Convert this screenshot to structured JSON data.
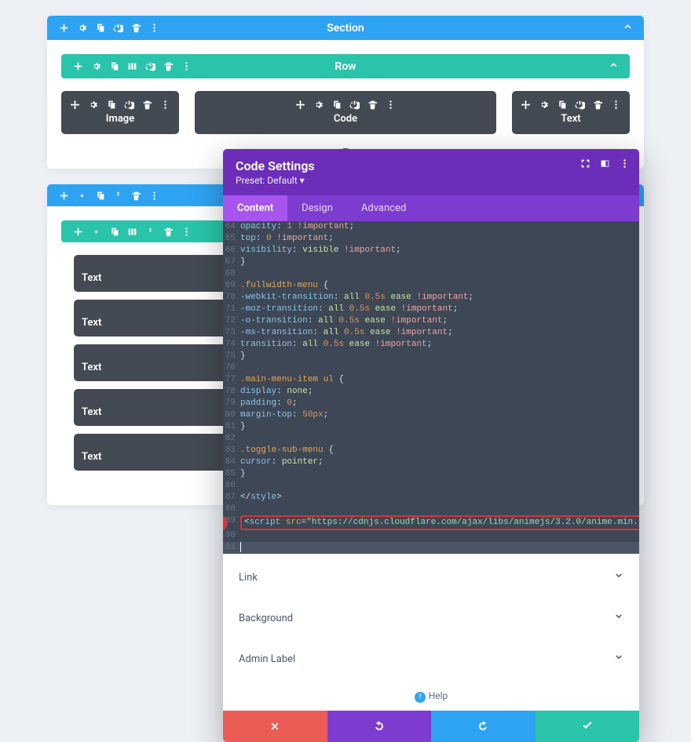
{
  "section1": {
    "title": "Section",
    "row": {
      "title": "Row",
      "mods": [
        "Image",
        "Code",
        "Text"
      ]
    }
  },
  "modal": {
    "title": "Code Settings",
    "preset": "Preset: Default",
    "tabs": [
      "Content",
      "Design",
      "Advanced"
    ],
    "code": {
      "start": 64,
      "lines": [
        {
          "t": "prop-imp",
          "prop": "opacity",
          "val": "1"
        },
        {
          "t": "prop-imp",
          "prop": "top",
          "val": "0"
        },
        {
          "t": "prop-kw-imp",
          "prop": "visibility",
          "kw": "visible"
        },
        {
          "t": "brace-close"
        },
        {
          "t": "blank"
        },
        {
          "t": "sel",
          "text": ".fullwidth-menu {"
        },
        {
          "t": "trans",
          "prop": "-webkit-transition"
        },
        {
          "t": "trans",
          "prop": "-moz-transition"
        },
        {
          "t": "trans",
          "prop": "-o-transition"
        },
        {
          "t": "trans",
          "prop": "-ms-transition"
        },
        {
          "t": "trans",
          "prop": "transition"
        },
        {
          "t": "brace-close"
        },
        {
          "t": "blank"
        },
        {
          "t": "sel",
          "text": ".main-menu-item ul {"
        },
        {
          "t": "prop-kw",
          "prop": "display",
          "kw": "none"
        },
        {
          "t": "prop-num",
          "prop": "padding",
          "num": "0"
        },
        {
          "t": "prop-num",
          "prop": "margin-top",
          "num": "50px"
        },
        {
          "t": "brace-close"
        },
        {
          "t": "blank"
        },
        {
          "t": "sel",
          "text": ".toggle-sub-menu {"
        },
        {
          "t": "prop-kw",
          "prop": "cursor",
          "kw": "pointer"
        },
        {
          "t": "brace-close"
        },
        {
          "t": "blank"
        },
        {
          "t": "endstyle"
        },
        {
          "t": "blank"
        },
        {
          "t": "script",
          "callout": "1",
          "src": "https://cdnjs.cloudflare.com/ajax/libs/animejs/3.2.0/anime.min.js"
        },
        {
          "t": "blank"
        },
        {
          "t": "cursor"
        }
      ]
    },
    "accordion": [
      "Link",
      "Background",
      "Admin Label"
    ],
    "help": "Help"
  },
  "textmods": [
    "Text",
    "Text",
    "Text",
    "Text",
    "Text"
  ]
}
